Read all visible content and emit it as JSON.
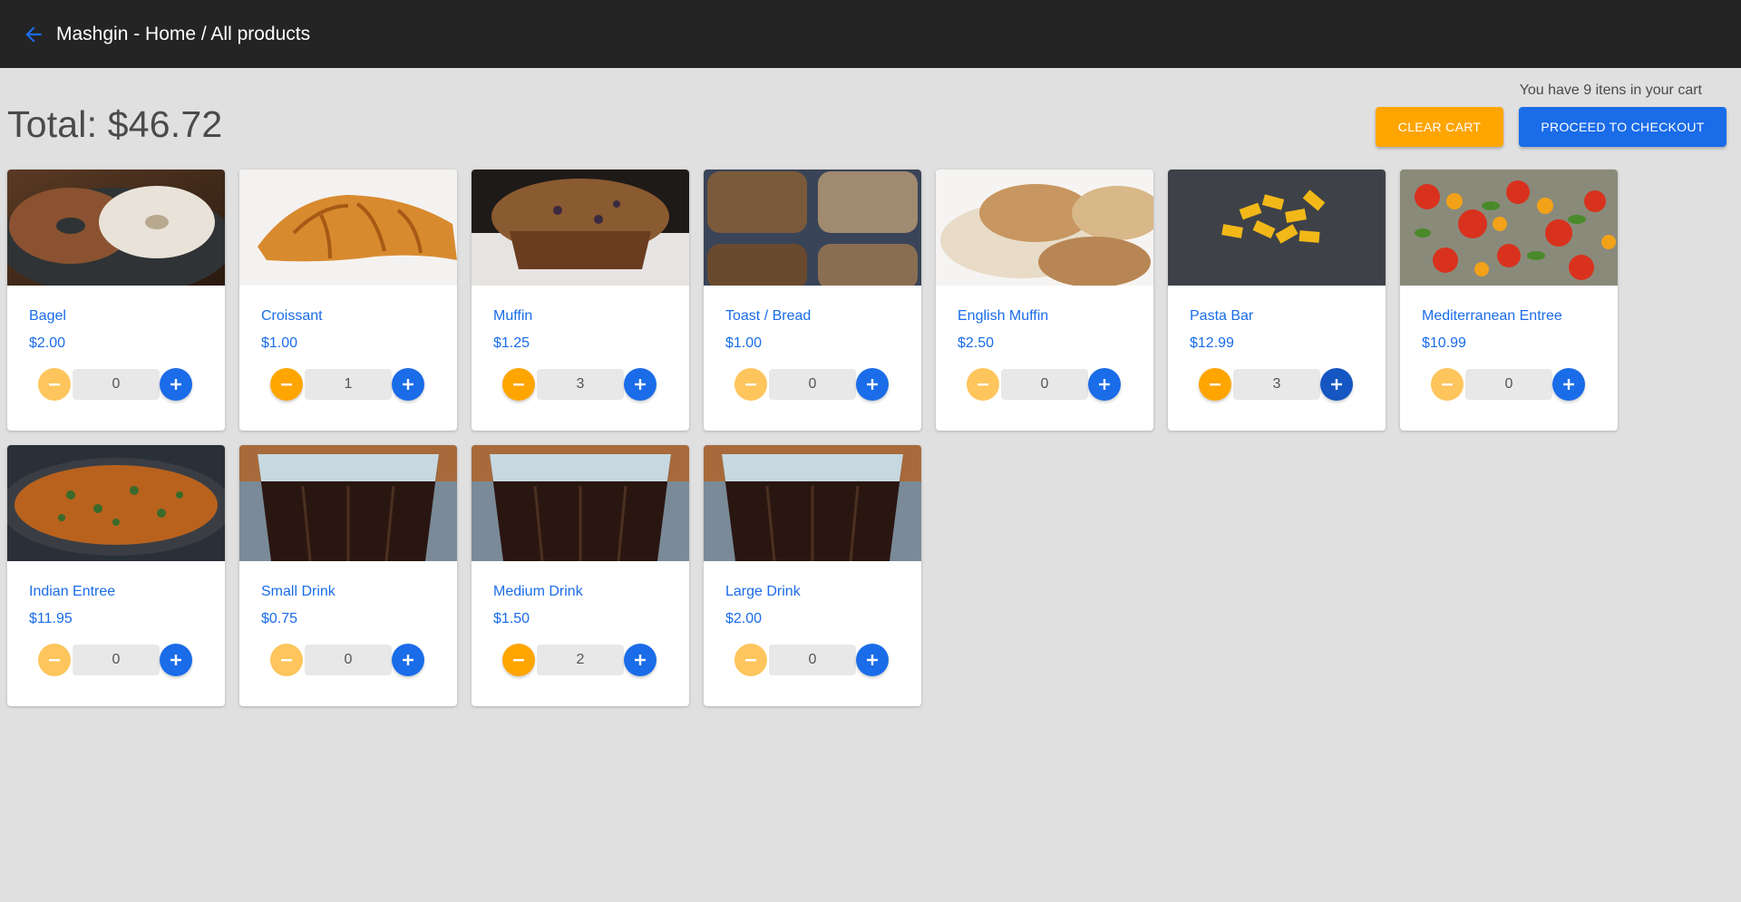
{
  "header": {
    "title": "Mashgin - Home / All products",
    "back_icon": "arrow-left-icon"
  },
  "cart": {
    "note": "You have 9 itens in your cart",
    "total": "Total: $46.72",
    "clear_label": "Clear cart",
    "checkout_label": "Proceed to checkout"
  },
  "colors": {
    "appbar": "#242424",
    "background": "#e0e0e0",
    "accent_blue": "#1a6ce8",
    "accent_orange": "#ffa500",
    "orange_disabled": "#fdc55c"
  },
  "products": [
    {
      "name": "Bagel",
      "price": "$2.00",
      "qty": "0",
      "image": "bagel-photo"
    },
    {
      "name": "Croissant",
      "price": "$1.00",
      "qty": "1",
      "image": "croissant-photo"
    },
    {
      "name": "Muffin",
      "price": "$1.25",
      "qty": "3",
      "image": "muffin-photo"
    },
    {
      "name": "Toast / Bread",
      "price": "$1.00",
      "qty": "0",
      "image": "toast-photo"
    },
    {
      "name": "English Muffin",
      "price": "$2.50",
      "qty": "0",
      "image": "english-muffin-photo"
    },
    {
      "name": "Pasta Bar",
      "price": "$12.99",
      "qty": "3",
      "image": "pasta-photo"
    },
    {
      "name": "Mediterranean Entree",
      "price": "$10.99",
      "qty": "0",
      "image": "salad-photo"
    },
    {
      "name": "Indian Entree",
      "price": "$11.95",
      "qty": "0",
      "image": "curry-photo"
    },
    {
      "name": "Small Drink",
      "price": "$0.75",
      "qty": "0",
      "image": "cola-photo"
    },
    {
      "name": "Medium Drink",
      "price": "$1.50",
      "qty": "2",
      "image": "cola-photo"
    },
    {
      "name": "Large Drink",
      "price": "$2.00",
      "qty": "0",
      "image": "cola-photo"
    }
  ]
}
